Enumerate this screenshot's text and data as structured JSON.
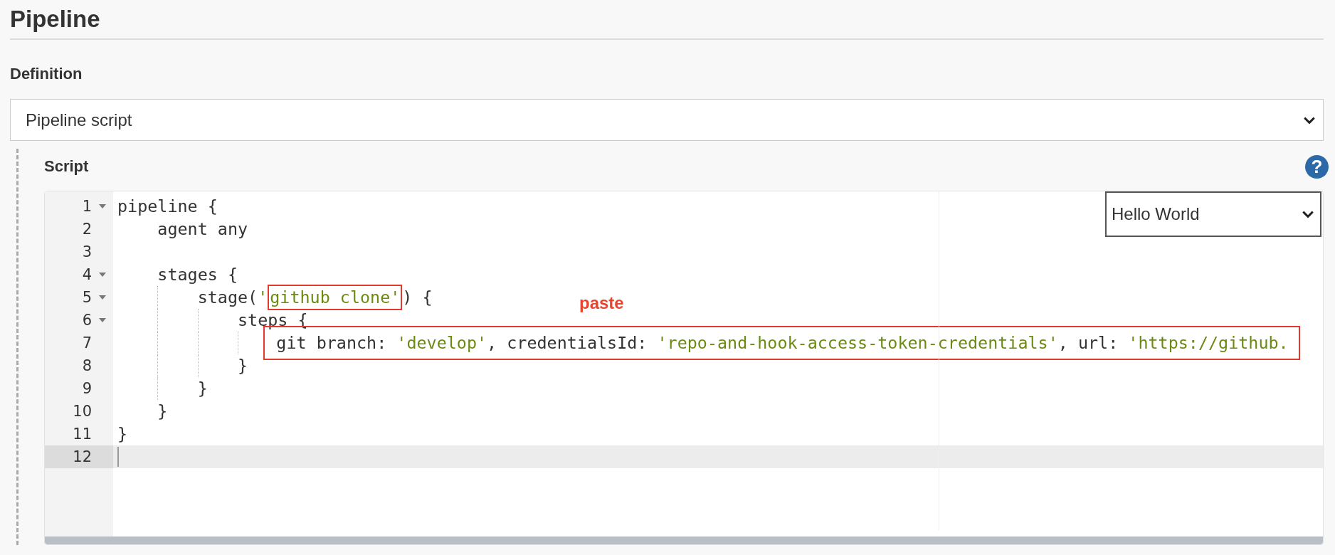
{
  "section": {
    "title": "Pipeline"
  },
  "definition": {
    "label": "Definition",
    "select": {
      "value": "Pipeline script"
    }
  },
  "script": {
    "label": "Script",
    "help": "?",
    "sample_select": {
      "value": "Hello World"
    },
    "annotation": "paste",
    "lines": [
      {
        "number": "1",
        "fold": true,
        "active": false,
        "segments": [
          {
            "kind": "plain",
            "text": "pipeline {"
          }
        ]
      },
      {
        "number": "2",
        "fold": false,
        "active": false,
        "segments": [
          {
            "kind": "plain",
            "text": "    agent any"
          }
        ]
      },
      {
        "number": "3",
        "fold": false,
        "active": false
      },
      {
        "number": "4",
        "fold": true,
        "active": false,
        "segments": [
          {
            "kind": "plain",
            "text": "    stages {"
          }
        ]
      },
      {
        "number": "5",
        "fold": true,
        "active": false,
        "segments": [
          {
            "kind": "plain",
            "text": "        stage("
          },
          {
            "kind": "string",
            "text": "'"
          },
          {
            "kind": "boxed",
            "segments": [
              {
                "kind": "string",
                "text": "github clone'"
              }
            ]
          },
          {
            "kind": "plain",
            "text": ") {"
          }
        ]
      },
      {
        "number": "6",
        "fold": true,
        "active": false,
        "segments": [
          {
            "kind": "plain",
            "text": "            steps {"
          }
        ]
      },
      {
        "number": "7",
        "fold": false,
        "active": false,
        "segments": [
          {
            "kind": "boxed",
            "wide": true,
            "segments": [
              {
                "kind": "plain",
                "text": "                git branch: "
              },
              {
                "kind": "string",
                "text": "'develop'"
              },
              {
                "kind": "plain",
                "text": ", credentialsId: "
              },
              {
                "kind": "string",
                "text": "'repo-and-hook-access-token-credentials'"
              },
              {
                "kind": "plain",
                "text": ", url: "
              },
              {
                "kind": "string",
                "text": "'https://github."
              }
            ]
          }
        ]
      },
      {
        "number": "8",
        "fold": false,
        "active": false,
        "segments": [
          {
            "kind": "plain",
            "text": "            }"
          }
        ]
      },
      {
        "number": "9",
        "fold": false,
        "active": false,
        "segments": [
          {
            "kind": "plain",
            "text": "        }"
          }
        ]
      },
      {
        "number": "10",
        "fold": false,
        "active": false,
        "segments": [
          {
            "kind": "plain",
            "text": "    }"
          }
        ]
      },
      {
        "number": "11",
        "fold": false,
        "active": false,
        "segments": [
          {
            "kind": "plain",
            "text": "}"
          }
        ]
      },
      {
        "number": "12",
        "fold": false,
        "active": true
      }
    ]
  }
}
